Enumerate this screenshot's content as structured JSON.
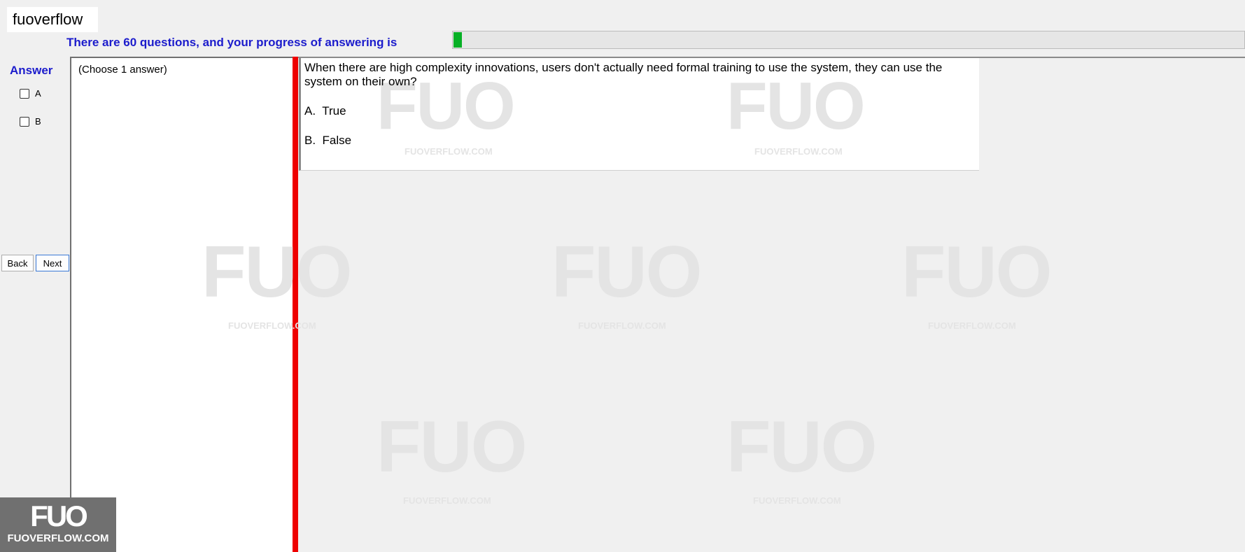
{
  "header": {
    "watermark_label": "fuoverflow",
    "progress_text": "There are 60 questions, and your progress of answering is",
    "progress_fraction": 0.01
  },
  "answer_panel": {
    "heading": "Answer",
    "options": [
      {
        "label": "A",
        "checked": false
      },
      {
        "label": "B",
        "checked": false
      }
    ]
  },
  "nav": {
    "back_label": "Back",
    "next_label": "Next"
  },
  "left_panel": {
    "instruction": "(Choose 1 answer)"
  },
  "question": {
    "text": "When there are high complexity innovations, users don't actually need formal training to use the system, they can use the system on their own?",
    "choices": [
      {
        "letter": "A.",
        "text": "True"
      },
      {
        "letter": "B.",
        "text": "False"
      }
    ]
  },
  "logo": {
    "mark": "FUO",
    "site": "FUOVERFLOW.COM"
  },
  "colors": {
    "heading_blue": "#1c1ccc",
    "progress_green": "#06b025",
    "divider_red": "#ee0000"
  }
}
